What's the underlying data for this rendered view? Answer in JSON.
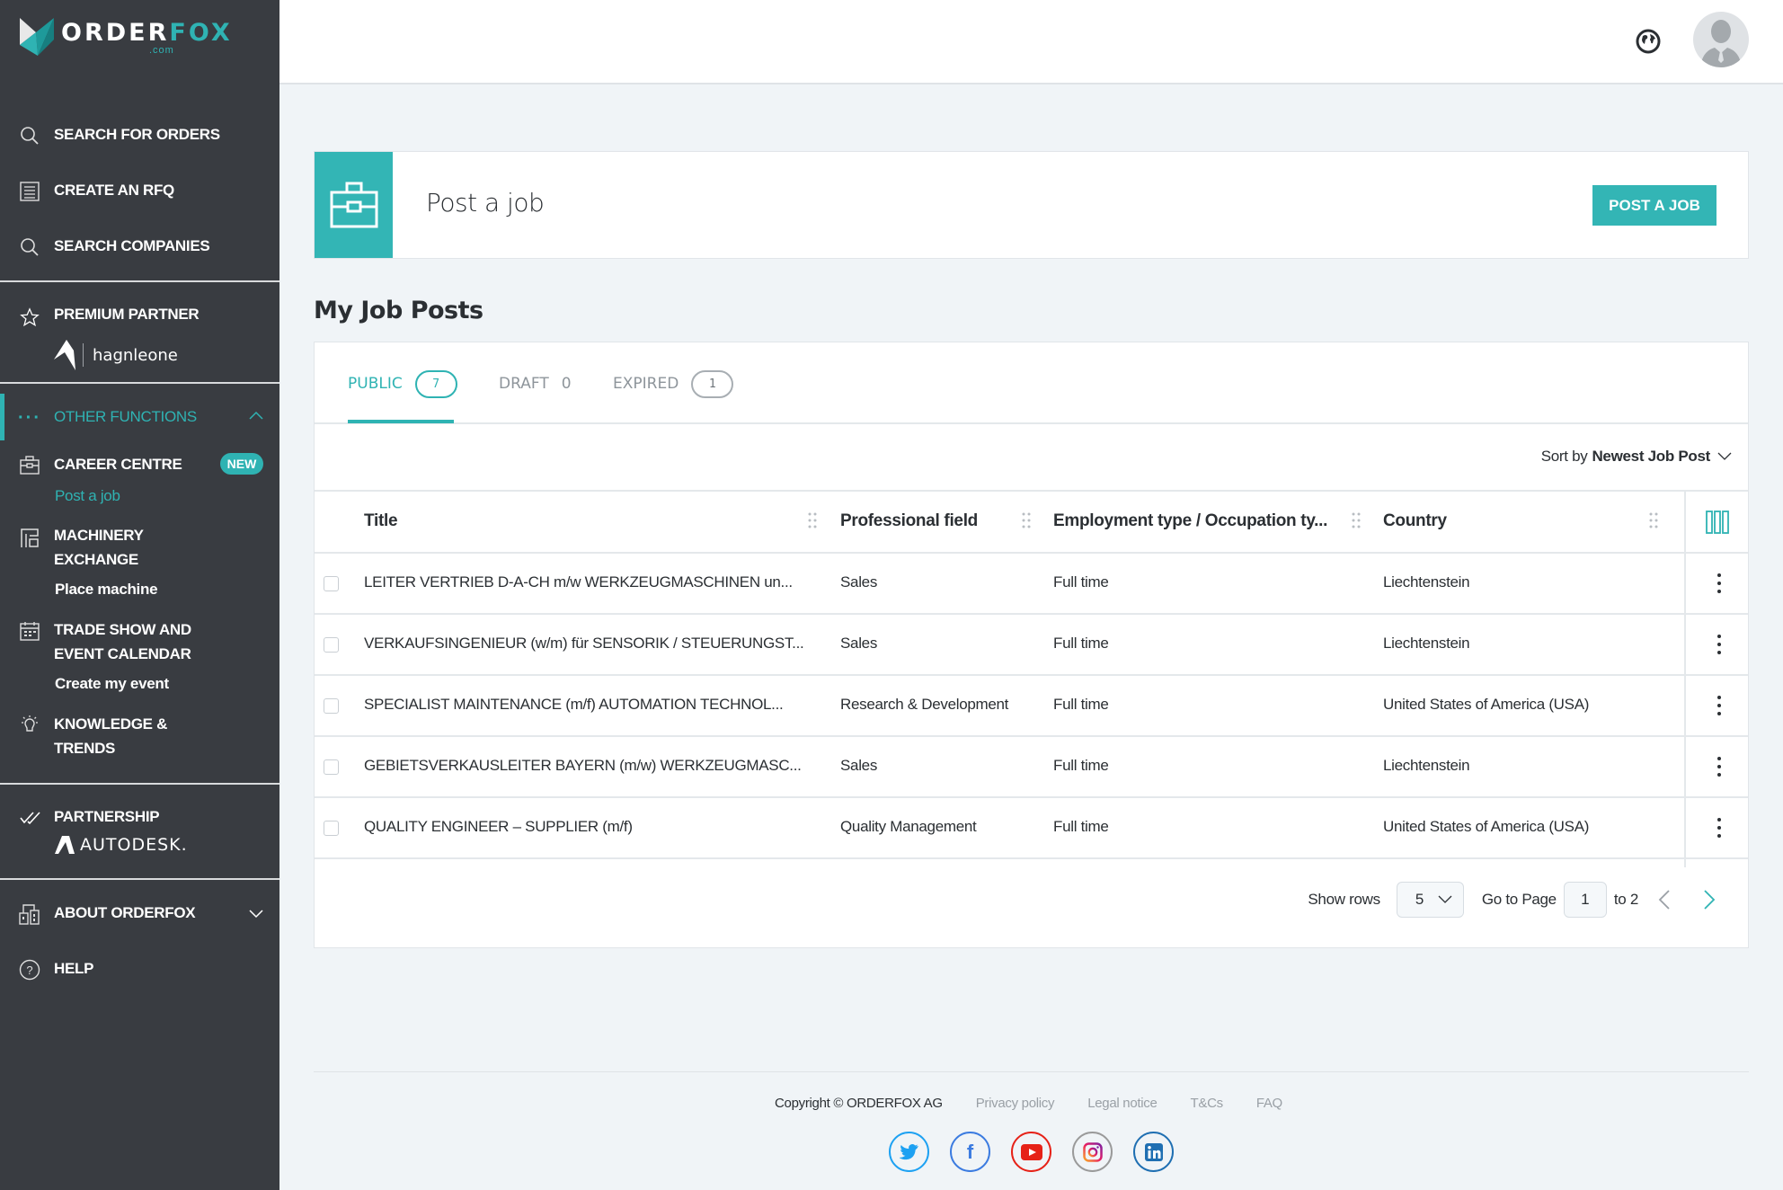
{
  "brand": {
    "name_main": "ORDER",
    "name_accent": "FOX",
    "suffix": ".com",
    "accent_color": "#2fb3b3",
    "sidebar_bg": "#393c41"
  },
  "sidebar": {
    "primary": [
      {
        "label": "SEARCH FOR ORDERS",
        "icon": "search-icon"
      },
      {
        "label": "CREATE AN RFQ",
        "icon": "list-icon"
      },
      {
        "label": "SEARCH COMPANIES",
        "icon": "search-icon"
      }
    ],
    "premium": {
      "label": "PREMIUM PARTNER",
      "partner_name": "hagnleone"
    },
    "other_functions": {
      "label": "OTHER FUNCTIONS",
      "items": [
        {
          "label": "CAREER CENTRE",
          "badge": "NEW",
          "sub": "Post a job"
        },
        {
          "label_line1": "MACHINERY",
          "label_line2": "EXCHANGE",
          "sub": "Place machine"
        },
        {
          "label_line1": "TRADE SHOW AND",
          "label_line2": "EVENT CALENDAR",
          "sub": "Create my event"
        },
        {
          "label_line1": "KNOWLEDGE &",
          "label_line2": "TRENDS"
        }
      ]
    },
    "partnership": {
      "label": "PARTNERSHIP",
      "partner_name": "AUTODESK."
    },
    "about": {
      "label": "ABOUT ORDERFOX"
    },
    "help": {
      "label": "HELP"
    }
  },
  "header": {
    "globe_icon": "globe-icon",
    "avatar": "user-avatar"
  },
  "post_card": {
    "title": "Post a job",
    "button": "POST A JOB"
  },
  "section_title": "My Job Posts",
  "tabs": [
    {
      "label": "PUBLIC",
      "count": "7",
      "active": true
    },
    {
      "label": "DRAFT",
      "count": "0",
      "active": false
    },
    {
      "label": "EXPIRED",
      "count": "1",
      "active": false
    }
  ],
  "sort": {
    "prefix": "Sort by",
    "value": "Newest Job Post"
  },
  "table": {
    "columns": [
      "Title",
      "Professional field",
      "Employment type / Occupation ty...",
      "Country"
    ],
    "rows": [
      {
        "title": "LEITER VERTRIEB D-A-CH m/w WERKZEUGMASCHINEN un...",
        "field": "Sales",
        "type": "Full time",
        "country": "Liechtenstein"
      },
      {
        "title": "VERKAUFSINGENIEUR (w/m) für SENSORIK / STEUERUNGST...",
        "field": "Sales",
        "type": "Full time",
        "country": "Liechtenstein"
      },
      {
        "title": "SPECIALIST MAINTENANCE (m/f) AUTOMATION TECHNOL...",
        "field": "Research & Development",
        "type": "Full time",
        "country": "United States of America (USA)"
      },
      {
        "title": "GEBIETSVERKAUSLEITER BAYERN (m/w) WERKZEUGMASC...",
        "field": "Sales",
        "type": "Full time",
        "country": "Liechtenstein"
      },
      {
        "title": "QUALITY ENGINEER – SUPPLIER (m/f)",
        "field": "Quality Management",
        "type": "Full time",
        "country": "United States of America (USA)"
      }
    ]
  },
  "pagination": {
    "show_rows_label": "Show rows",
    "rows_value": "5",
    "goto_label": "Go to Page",
    "page_value": "1",
    "total_label": "to 2"
  },
  "footer": {
    "copyright": "Copyright © ORDERFOX AG",
    "links": [
      "Privacy policy",
      "Legal notice",
      "T&Cs",
      "FAQ"
    ],
    "socials": [
      {
        "name": "twitter",
        "color": "#1da1f2"
      },
      {
        "name": "facebook",
        "color": "#3b7be0"
      },
      {
        "name": "youtube",
        "color": "#e62117"
      },
      {
        "name": "instagram",
        "color": "#9a9a9a"
      },
      {
        "name": "linkedin",
        "color": "#1f6fb2"
      }
    ]
  }
}
